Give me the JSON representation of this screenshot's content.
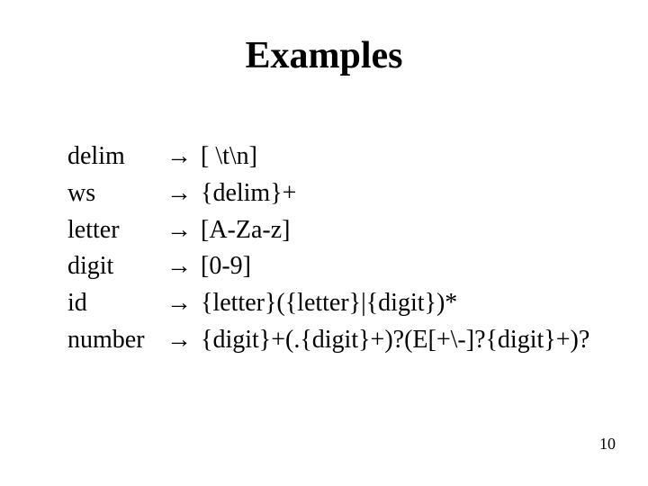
{
  "title": "Examples",
  "arrow_glyph": "→",
  "rules": [
    {
      "name": "delim",
      "rhs": "[ \\t\\n]"
    },
    {
      "name": "ws",
      "rhs": "{delim}+"
    },
    {
      "name": "letter",
      "rhs": "[A-Za-z]"
    },
    {
      "name": "digit",
      "rhs": "[0-9]"
    },
    {
      "name": "id",
      "rhs": "{letter}({letter}|{digit})*"
    },
    {
      "name": "number",
      "rhs": "{digit}+(.{digit}+)?(E[+\\-]?{digit}+)?"
    }
  ],
  "page_number": "10"
}
